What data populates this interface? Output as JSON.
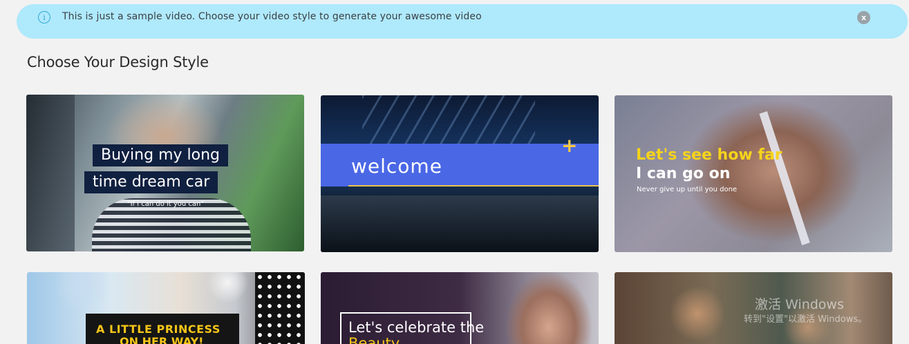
{
  "banner": {
    "message": "This is just a sample video. Choose your video style to generate your awesome video",
    "info_icon": "i",
    "close_icon": "x"
  },
  "page": {
    "title": "Choose Your Design Style"
  },
  "cards": [
    {
      "line1": "Buying my long",
      "line2": "time dream car",
      "subtitle": "\"If i can do it you can\""
    },
    {
      "headline": "welcome",
      "plus": "+"
    },
    {
      "line1": "Let's see how far",
      "line2": "I can go on",
      "subtitle": "Never give up until you done"
    },
    {
      "line1": "A LITTLE PRINCESS",
      "line2": "ON HER WAY!"
    },
    {
      "line1": "Let's celebrate the",
      "line2": "Beauty"
    },
    {}
  ],
  "watermark": {
    "line1": "激活 Windows",
    "line2": "转到\"设置\"以激活 Windows。"
  }
}
